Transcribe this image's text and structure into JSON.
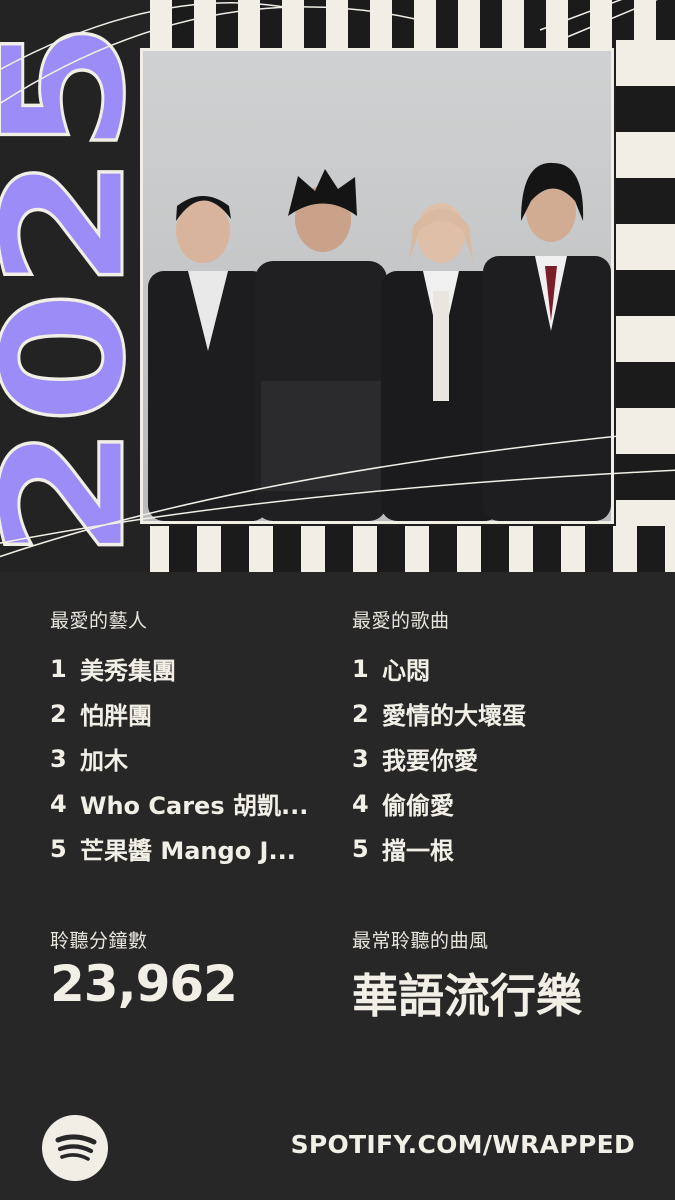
{
  "year": "2025",
  "top_artists": {
    "label": "最愛的藝人",
    "items": [
      {
        "rank": "1",
        "name": "美秀集團"
      },
      {
        "rank": "2",
        "name": "怕胖團"
      },
      {
        "rank": "3",
        "name": "加木"
      },
      {
        "rank": "4",
        "name": "Who Cares 胡凱..."
      },
      {
        "rank": "5",
        "name": "芒果醬 Mango J..."
      }
    ]
  },
  "top_songs": {
    "label": "最愛的歌曲",
    "items": [
      {
        "rank": "1",
        "name": "心悶"
      },
      {
        "rank": "2",
        "name": "愛情的大壞蛋"
      },
      {
        "rank": "3",
        "name": "我要你愛"
      },
      {
        "rank": "4",
        "name": "偷偷愛"
      },
      {
        "rank": "5",
        "name": "擋一根"
      }
    ]
  },
  "minutes": {
    "label": "聆聽分鐘數",
    "value": "23,962"
  },
  "genre": {
    "label": "最常聆聽的曲風",
    "value": "華語流行樂"
  },
  "footer": {
    "url": "SPOTIFY.COM/WRAPPED",
    "logo_icon": "spotify-logo-icon"
  },
  "colors": {
    "background": "#272727",
    "accent_purple": "#9b8cf7",
    "cream": "#f1eee6"
  }
}
